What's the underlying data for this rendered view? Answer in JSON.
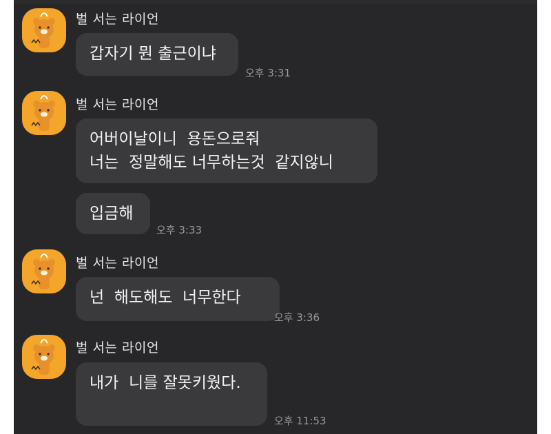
{
  "chat": {
    "messages": [
      {
        "sender": "벌 서는 라이언",
        "avatar_icon": "ryan-punished-avatar-icon",
        "bubbles": [
          {
            "text": "갑자기 뭔 출근이냐",
            "time": "오후 3:31"
          }
        ]
      },
      {
        "sender": "벌 서는 라이언",
        "avatar_icon": "ryan-punished-avatar-icon",
        "bubbles": [
          {
            "text": "어버이날이니  용돈으로줘\n너는  정말해도 너무하는것  같지않니",
            "time": ""
          },
          {
            "text": "입금해",
            "time": "오후 3:33"
          }
        ]
      },
      {
        "sender": "벌 서는 라이언",
        "avatar_icon": "ryan-punished-avatar-icon",
        "bubbles": [
          {
            "text": "넌  해도해도  너무한다",
            "time": "오후 3:36"
          }
        ]
      },
      {
        "sender": "벌 서는 라이언",
        "avatar_icon": "ryan-punished-avatar-icon",
        "bubbles": [
          {
            "text": "내가  니를 잘못키웠다.",
            "time": "오후 11:53"
          }
        ]
      }
    ]
  },
  "colors": {
    "background": "#272729",
    "bubble": "#3a3a3d",
    "avatar": "#f4a62a",
    "text": "#f2f2f2",
    "time": "#9a9a9e"
  }
}
